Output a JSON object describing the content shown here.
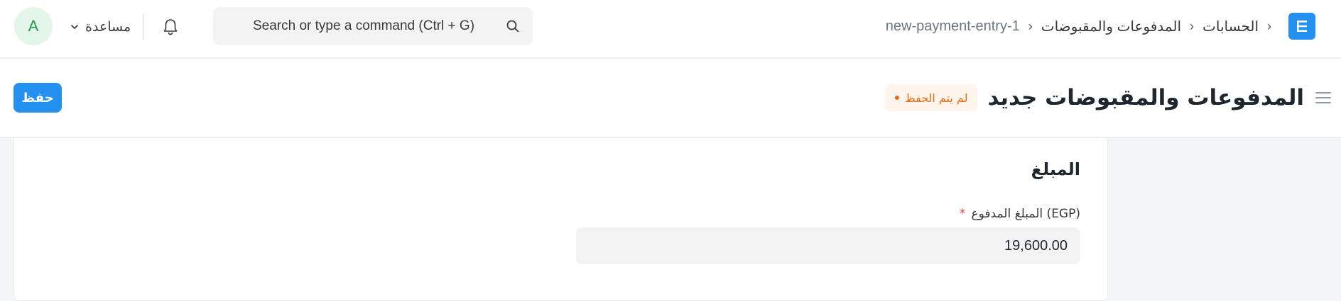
{
  "navbar": {
    "avatar_initial": "A",
    "help_label": "مساعدة",
    "search_placeholder": "Search or type a command (Ctrl + G)",
    "breadcrumbs": [
      "الحسابات",
      "المدفوعات والمقبوضات",
      "new-payment-entry-1"
    ],
    "breadcrumb_separator": "›",
    "logo_letter": "E",
    "icons": [
      "bell-icon",
      "search-icon",
      "chevron-down-icon",
      "logo-icon"
    ]
  },
  "page_head": {
    "title": "المدفوعات والمقبوضات جديد",
    "status_badge": "لم يتم الحفظ",
    "save_label": "حفظ",
    "icons": [
      "hamburger-icon"
    ]
  },
  "form": {
    "section_title": "المبلغ",
    "paid_amount_label": "المبلغ المدفوع (EGP)",
    "required_marker": "*",
    "paid_amount_value": "19,600.00"
  },
  "colors": {
    "accent": "#2490ef",
    "status_orange": "#e86c13",
    "status_bg": "#fff5ed",
    "avatar_bg": "#e4f5e9",
    "avatar_fg": "#2d9d4e",
    "required_red": "#e24c4c"
  }
}
